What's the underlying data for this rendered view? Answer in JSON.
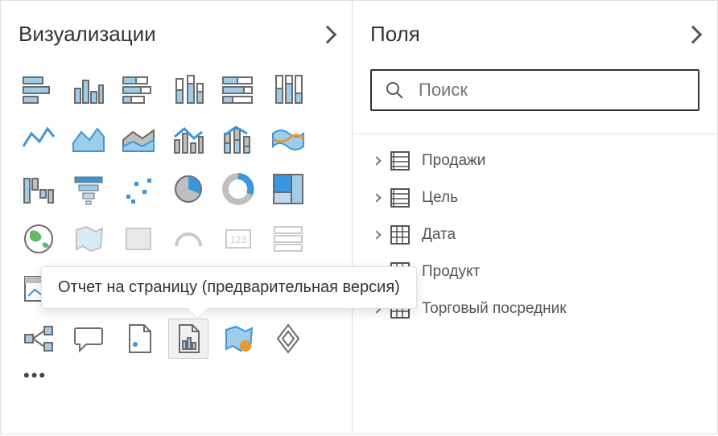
{
  "visualizations": {
    "title": "Визуализации",
    "tooltip": "Отчет на страницу (предварительная версия)",
    "icons": [
      "stacked-bar-h",
      "clustered-bar-v",
      "stacked-bar-h-100",
      "clustered-bar-v-2",
      "stacked-bar-h-alt",
      "column-line",
      "line",
      "area",
      "area-stacked",
      "column-line-combo",
      "column-line-combo-2",
      "ribbon",
      "waterfall",
      "funnel",
      "scatter",
      "pie",
      "donut",
      "treemap",
      "map-globe",
      "filled-map",
      "card",
      "kpi",
      "gauge",
      "multi-row",
      "table",
      "matrix",
      "slicer",
      "ai-visual",
      "py-visual",
      "tree-decomp",
      "key-influencers",
      "qa",
      "r-visual",
      "paginated-report",
      "arcgis",
      "custom-visual"
    ]
  },
  "fields": {
    "title": "Поля",
    "search_placeholder": "Поиск",
    "items": [
      {
        "label": "Продажи",
        "icon": "calc-table"
      },
      {
        "label": "Цель",
        "icon": "calc-table"
      },
      {
        "label": "Дата",
        "icon": "grid-table"
      },
      {
        "label": "Продукт",
        "icon": "grid-table"
      },
      {
        "label": "Торговый посредник",
        "icon": "grid-table"
      }
    ]
  },
  "colors": {
    "accent": "#3a96dd",
    "accent_fill": "#9fcde9",
    "orange": "#e8982e",
    "gray_stroke": "#6b6b6b",
    "gray_light": "#bfbfbf"
  }
}
